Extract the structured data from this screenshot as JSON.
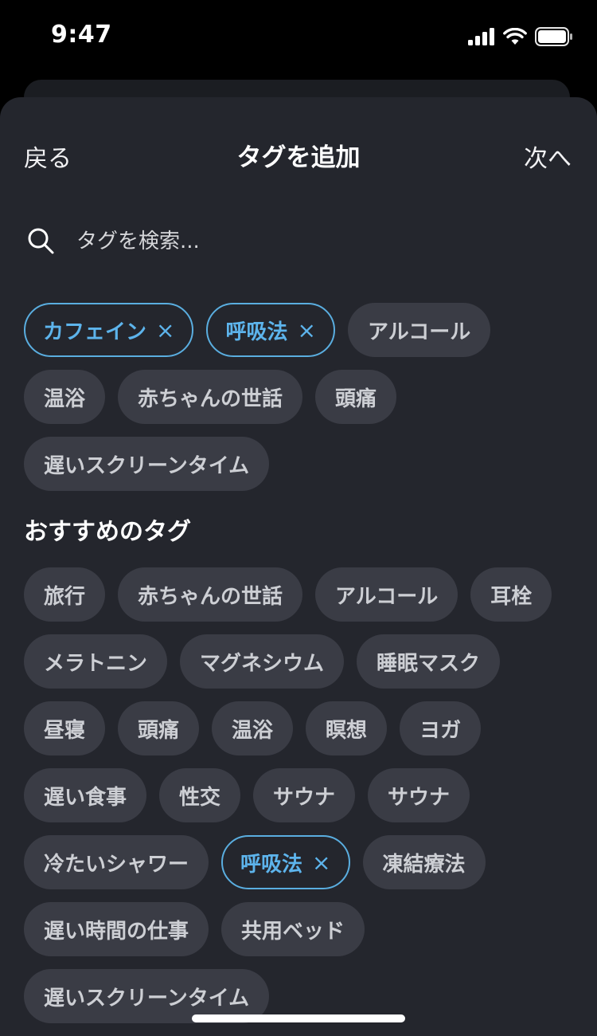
{
  "status_bar": {
    "time": "9:47"
  },
  "nav": {
    "back": "戻る",
    "title": "タグを追加",
    "next": "次へ"
  },
  "search": {
    "placeholder": "タグを検索..."
  },
  "selected_tags": [
    {
      "label": "カフェイン",
      "active": true
    },
    {
      "label": "呼吸法",
      "active": true
    },
    {
      "label": "アルコール",
      "active": false
    },
    {
      "label": "温浴",
      "active": false
    },
    {
      "label": "赤ちゃんの世話",
      "active": false
    },
    {
      "label": "頭痛",
      "active": false
    },
    {
      "label": "遅いスクリーンタイム",
      "active": false
    }
  ],
  "suggested": {
    "title": "おすすめのタグ",
    "tags": [
      {
        "label": "旅行",
        "active": false
      },
      {
        "label": "赤ちゃんの世話",
        "active": false
      },
      {
        "label": "アルコール",
        "active": false
      },
      {
        "label": "耳栓",
        "active": false
      },
      {
        "label": "メラトニン",
        "active": false
      },
      {
        "label": "マグネシウム",
        "active": false
      },
      {
        "label": "睡眠マスク",
        "active": false
      },
      {
        "label": "昼寝",
        "active": false
      },
      {
        "label": "頭痛",
        "active": false
      },
      {
        "label": "温浴",
        "active": false
      },
      {
        "label": "瞑想",
        "active": false
      },
      {
        "label": "ヨガ",
        "active": false
      },
      {
        "label": "遅い食事",
        "active": false
      },
      {
        "label": "性交",
        "active": false
      },
      {
        "label": "サウナ",
        "active": false
      },
      {
        "label": "サウナ",
        "active": false
      },
      {
        "label": "冷たいシャワー",
        "active": false
      },
      {
        "label": "呼吸法",
        "active": true
      },
      {
        "label": "凍結療法",
        "active": false
      },
      {
        "label": "遅い時間の仕事",
        "active": false
      },
      {
        "label": "共用ベッド",
        "active": false
      },
      {
        "label": "遅いスクリーンタイム",
        "active": false
      }
    ]
  },
  "remove_glyph": "×",
  "colors": {
    "accent": "#5db4ec",
    "sheet": "#24262d",
    "chip": "#3a3c45"
  }
}
